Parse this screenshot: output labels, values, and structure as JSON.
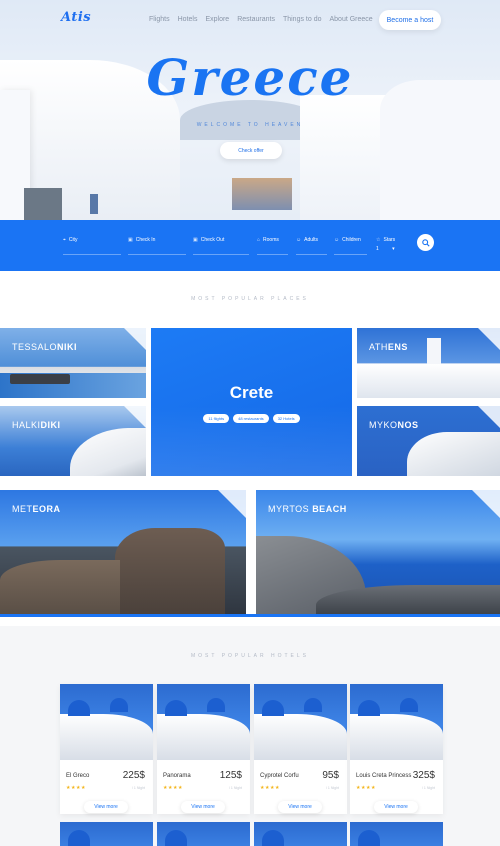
{
  "nav": {
    "logo": "Atis",
    "menu": [
      "Flights",
      "Hotels",
      "Explore",
      "Restaurants",
      "Things to do",
      "About Greece"
    ],
    "host_button": "Become a host"
  },
  "hero": {
    "title": "Greece",
    "subtitle": "WELCOME TO HEAVEN",
    "cta": "Check offer"
  },
  "search": {
    "fields": [
      "City",
      "Check In",
      "Check Out",
      "Rooms",
      "Adults",
      "Children",
      "Stars"
    ],
    "stars_value": "1",
    "button_icon": "search-icon"
  },
  "places": {
    "heading": "MOST POPULAR PLACES",
    "tiles": [
      {
        "light": "TESSALO",
        "bold": "NIKI"
      },
      {
        "light": "HALKI",
        "bold": "DIKI"
      },
      {
        "light": "ATH",
        "bold": "ENS"
      },
      {
        "light": "MYKO",
        "bold": "NOS"
      },
      {
        "light": "MET",
        "bold": "EORA"
      },
      {
        "light": "MYRTOS ",
        "bold": "BEACH"
      }
    ],
    "featured": {
      "title": "Crete",
      "pills": [
        "11 flights",
        "48 restaurants",
        "32 Hotels"
      ]
    }
  },
  "hotels": {
    "heading": "MOST POPULAR HOTELS",
    "items": [
      {
        "name": "El Greco",
        "price": "225$",
        "stars": "★★★★",
        "sub": "/ 1 Night",
        "button": "View more"
      },
      {
        "name": "Panorama",
        "price": "125$",
        "stars": "★★★★",
        "sub": "/ 1 Night",
        "button": "View more"
      },
      {
        "name": "Cyprotel Corfu",
        "price": "95$",
        "stars": "★★★★",
        "sub": "/ 1 Night",
        "button": "View more"
      },
      {
        "name": "Louis Creta Princess",
        "price": "325$",
        "stars": "★★★★",
        "sub": "/ 1 Night",
        "button": "View more"
      }
    ]
  },
  "colors": {
    "accent": "#1a74f4",
    "star": "#f3b51c"
  }
}
